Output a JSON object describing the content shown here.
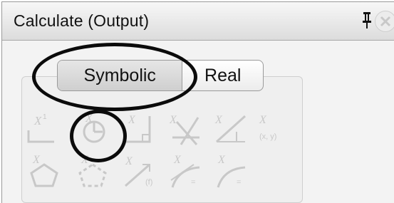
{
  "panel": {
    "title": "Calculate (Output)"
  },
  "tabs": {
    "symbolic": "Symbolic",
    "real": "Real",
    "selected": "Symbolic"
  },
  "toolbar": {
    "icons": [
      {
        "name": "equation-line-icon"
      },
      {
        "name": "circle-icon"
      },
      {
        "name": "angle-icon"
      },
      {
        "name": "line-intersect-icon"
      },
      {
        "name": "parallel-line-icon"
      },
      {
        "name": "point-xy-icon"
      },
      {
        "name": "pentagon-icon"
      },
      {
        "name": "polygon-dashed-icon"
      },
      {
        "name": "slope-icon"
      },
      {
        "name": "curve-tangent-icon"
      },
      {
        "name": "curve-point-icon"
      }
    ]
  },
  "colors": {
    "icon_disabled": "#c8c8c8",
    "highlight_ring": "#0b0b0b"
  }
}
